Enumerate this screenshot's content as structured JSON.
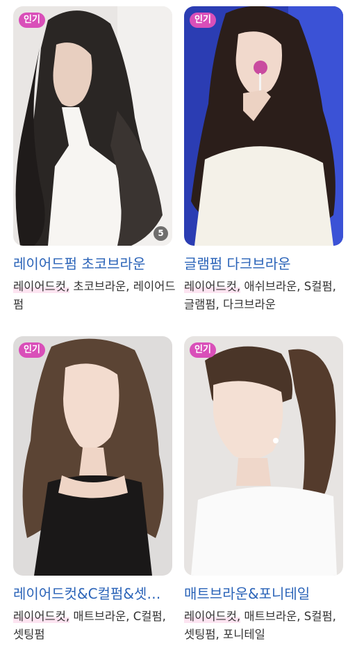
{
  "cards": [
    {
      "badge": "인기",
      "title": "레이어드펌 초코브라운",
      "tag_first": "레이어드컷,",
      "tag_rest": " 초코브라운, 레이어드펌",
      "count": "5",
      "image": "woman-long-dark-wavy-hair-white-shirt"
    },
    {
      "badge": "인기",
      "title": "글램펌 다크브라운",
      "tag_first": "레이어드컷,",
      "tag_rest": " 애쉬브라운, S컬펌, 글램펌, 다크브라운",
      "image": "woman-curly-dark-hair-lollipop-blue-background"
    },
    {
      "badge": "인기",
      "title": "레이어드컷&C컬펌&셋팅펌",
      "tag_first": "레이어드컷,",
      "tag_rest": " 매트브라운, C컬펌, 셋팅펌",
      "image": "woman-layered-brown-hair-black-top"
    },
    {
      "badge": "인기",
      "title": "매트브라운&포니테일",
      "tag_first": "레이어드컷,",
      "tag_rest": " 매트브라운, S컬펌, 셋팅펌, 포니테일",
      "image": "woman-ponytail-brown-hair-white-blouse"
    }
  ],
  "colors": {
    "badge": "#d94fb9",
    "title": "#2a63b8",
    "highlight": "#fde4f1"
  }
}
